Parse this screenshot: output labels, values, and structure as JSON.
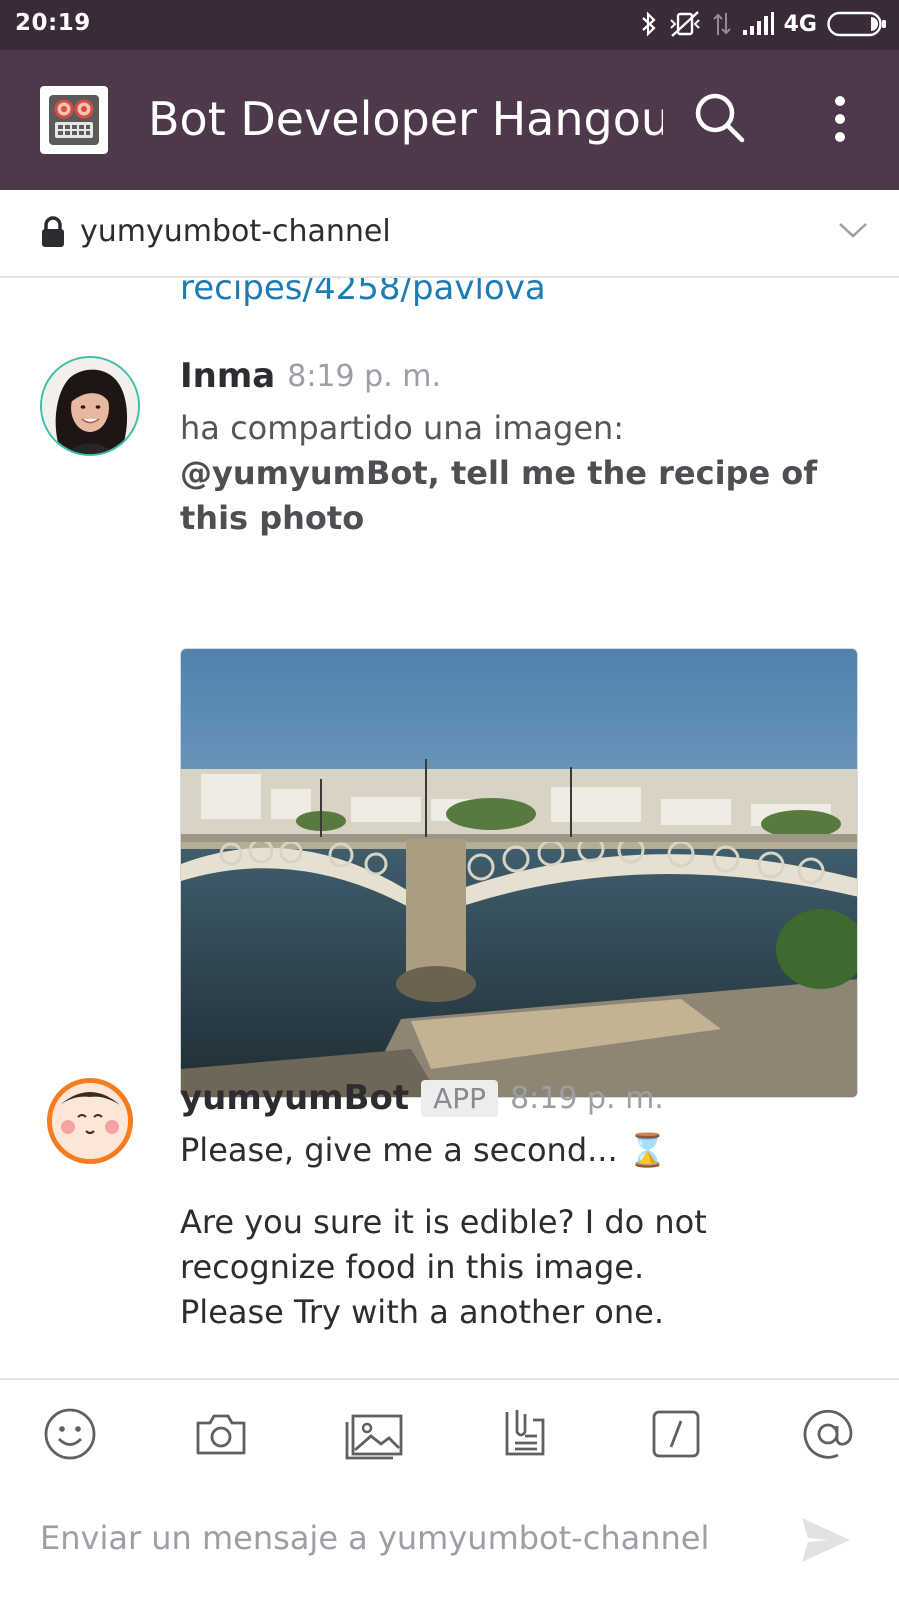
{
  "status_bar": {
    "time": "20:19",
    "network": "4G"
  },
  "header": {
    "team_name": "Bot Developer Hangout"
  },
  "channel": {
    "name": "yumyumbot-channel"
  },
  "messages": {
    "previous_link": "recipes/4258/pavlova",
    "inma": {
      "author": "Inma",
      "time": "8:19 p. m.",
      "shared": "ha compartido una imagen:",
      "caption": "@yumyumBot, tell me the recipe of this photo"
    },
    "bot": {
      "author": "yumyumBot",
      "badge": "APP",
      "time": "8:19 p. m.",
      "line1": "Please, give me a second...",
      "line1_emoji": "⌛",
      "reply": "Are you sure it is edible? I do not recognize food in this image. Please Try with a another one."
    }
  },
  "composer": {
    "placeholder": "Enviar un mensaje a yumyumbot-channel"
  },
  "colors": {
    "header_bg": "#4d394b",
    "status_bg": "#3b2a3a",
    "link": "#1d7cb4",
    "bot_avatar_ring": "#f57c1f"
  }
}
